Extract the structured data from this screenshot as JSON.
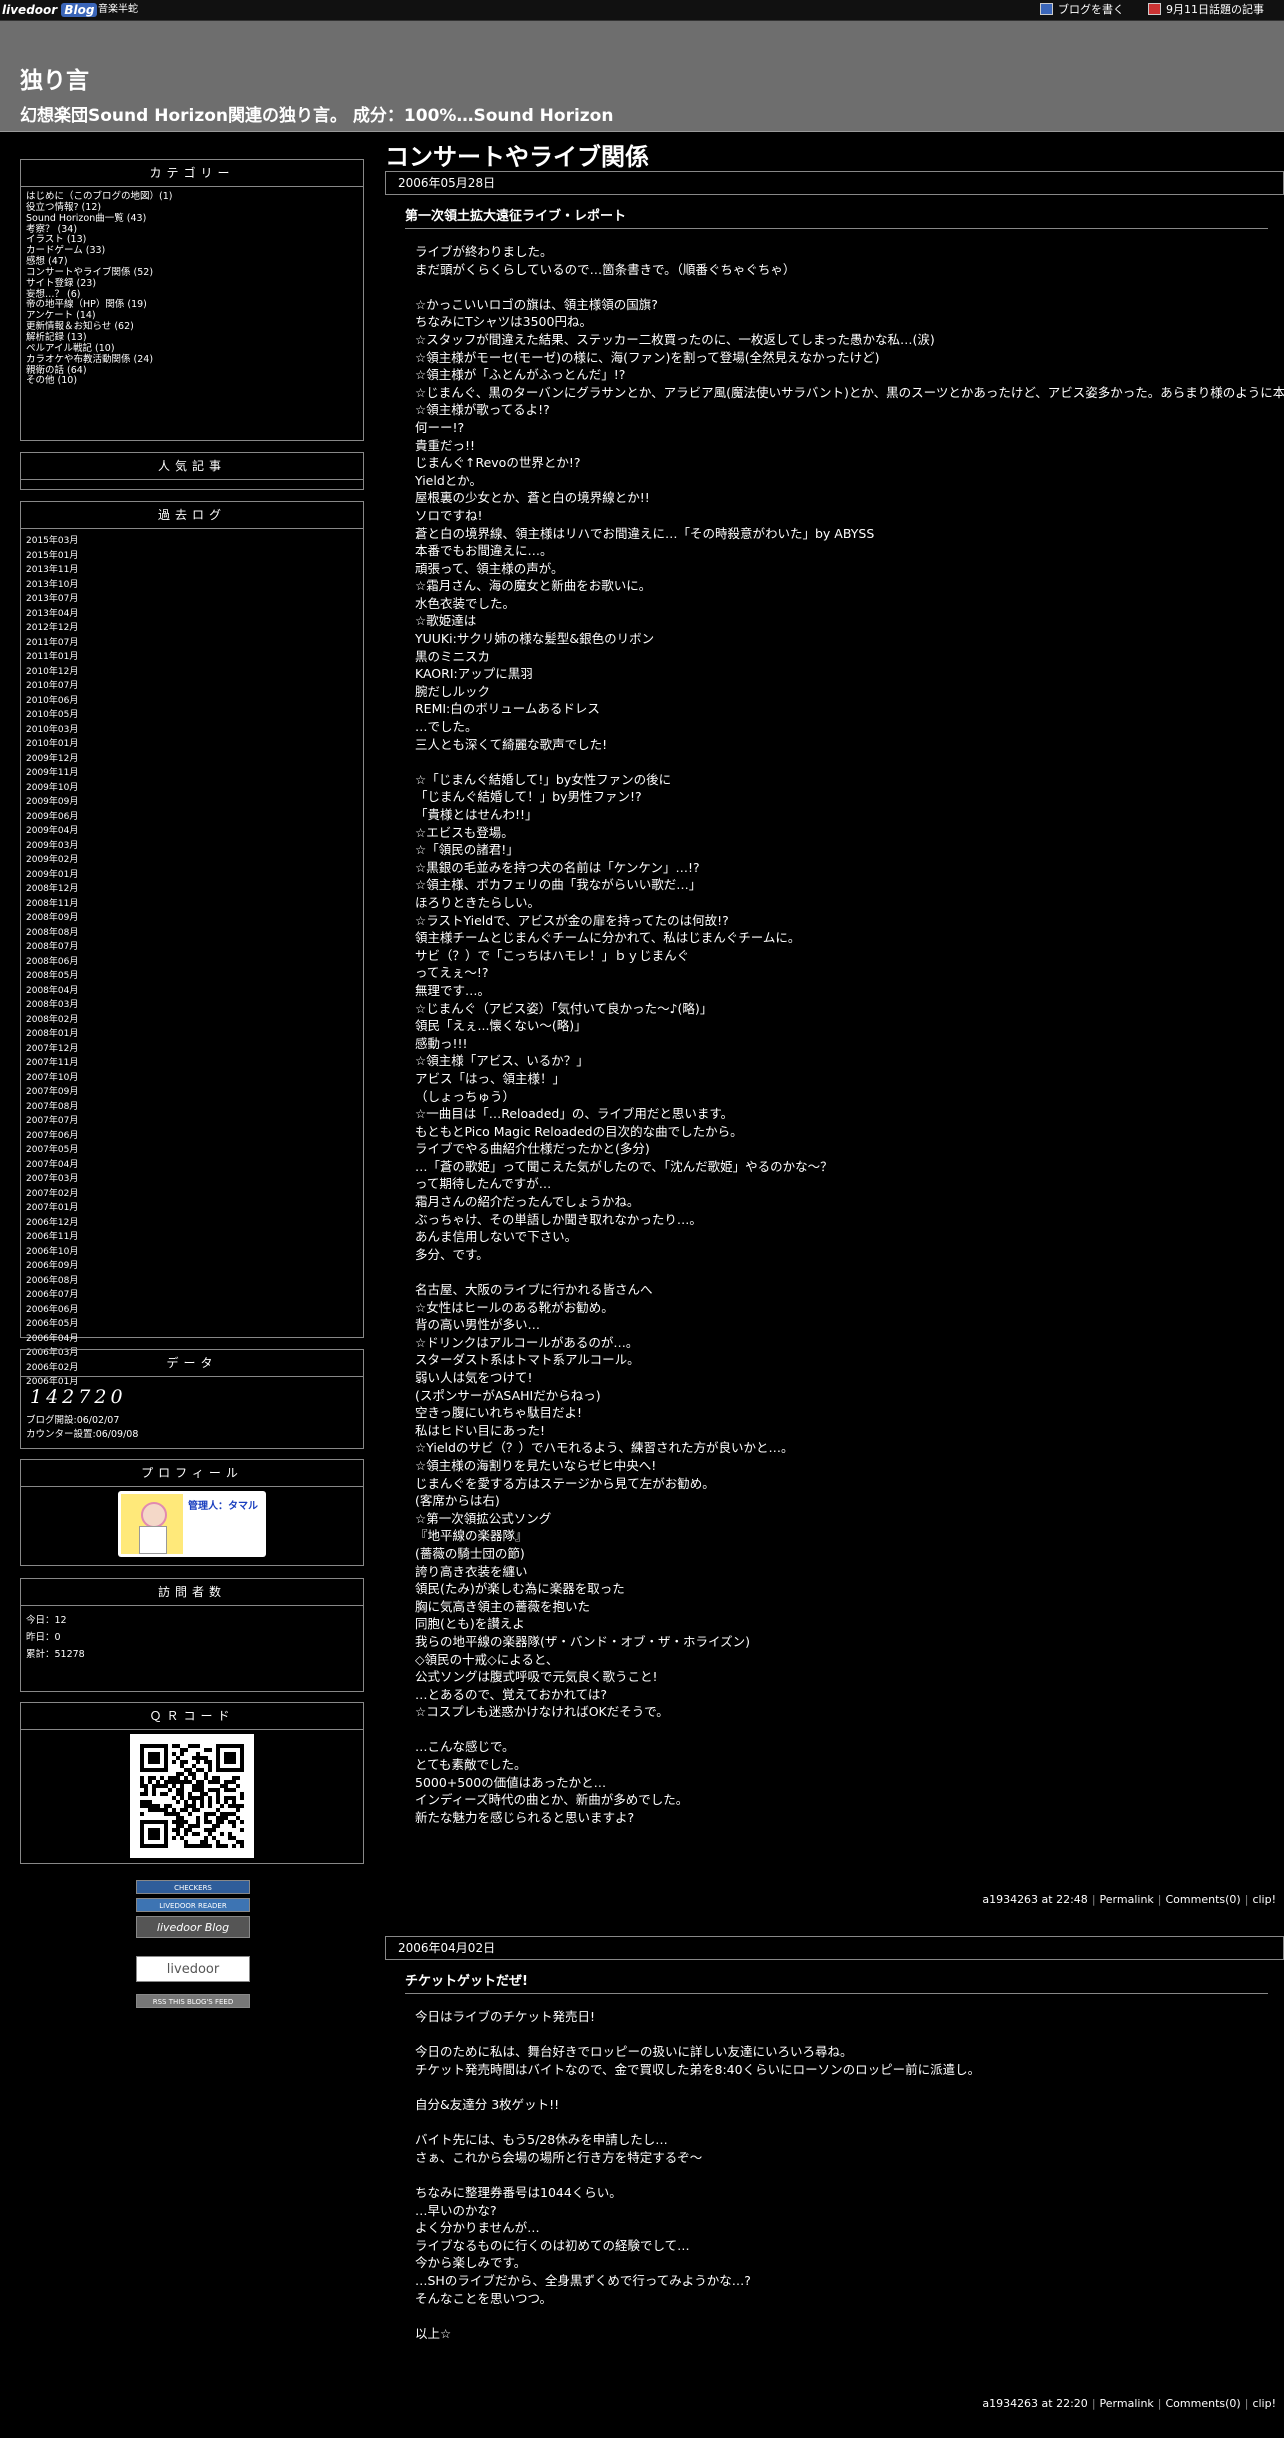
{
  "topbar": {
    "logo_text": "livedoor",
    "logo_blog": "Blog",
    "subtitle": "音楽半蛇",
    "write_label": "ブログを書く",
    "news_label": "9月11日話題の記事"
  },
  "header": {
    "title": "独り言",
    "description": "幻想楽団Sound Horizon関連の独り言。 成分：100%…Sound Horizon"
  },
  "sidebar": {
    "categories": {
      "title": "カテゴリー",
      "items": [
        "はじめに（このブログの地図）(1)",
        "役立つ情報? (12)",
        "Sound Horizon曲一覧 (43)",
        "考察？ (34)",
        "イラスト (13)",
        "カードゲーム (33)",
        "感想 (47)",
        "コンサートやライブ関係 (52)",
        "サイト登録 (23)",
        "妄想…？ (6)",
        "帝の地平線（HP）関係 (19)",
        "アンケート (14)",
        "更新情報＆お知らせ (62)",
        "解析記録 (13)",
        "ペルアイル戦記 (10)",
        "カラオケや布教活動関係 (24)",
        "親衛の話 (64)",
        "その他 (10)"
      ]
    },
    "popular": {
      "title": "人気記事"
    },
    "archives": {
      "title": "過去ログ",
      "items": [
        "2015年03月",
        "2015年01月",
        "2013年11月",
        "2013年10月",
        "2013年07月",
        "2013年04月",
        "2012年12月",
        "2011年07月",
        "2011年01月",
        "2010年12月",
        "2010年07月",
        "2010年06月",
        "2010年05月",
        "2010年03月",
        "2010年01月",
        "2009年12月",
        "2009年11月",
        "2009年10月",
        "2009年09月",
        "2009年06月",
        "2009年04月",
        "2009年03月",
        "2009年02月",
        "2009年01月",
        "2008年12月",
        "2008年11月",
        "2008年09月",
        "2008年08月",
        "2008年07月",
        "2008年06月",
        "2008年05月",
        "2008年04月",
        "2008年03月",
        "2008年02月",
        "2008年01月",
        "2007年12月",
        "2007年11月",
        "2007年10月",
        "2007年09月",
        "2007年08月",
        "2007年07月",
        "2007年06月",
        "2007年05月",
        "2007年04月",
        "2007年03月",
        "2007年02月",
        "2007年01月",
        "2006年12月",
        "2006年11月",
        "2006年10月",
        "2006年09月",
        "2006年08月",
        "2006年07月",
        "2006年06月",
        "2006年05月",
        "2006年04月",
        "2006年03月",
        "2006年02月",
        "2006年01月"
      ]
    },
    "data_box": {
      "title": "データ",
      "counter": "142720",
      "opened": "ブログ開設:06/02/07",
      "counter_set": "カウンター設置:06/09/08"
    },
    "profile": {
      "title": "プロフィール",
      "label": "管理人：タマル"
    },
    "visitors": {
      "title": "訪問者数",
      "today": "今日：12",
      "yesterday": "昨日：0",
      "total": "累計：51278"
    },
    "qr": {
      "title": "ＱＲコード"
    },
    "badges": [
      "CHECKERS",
      "LIVEDOOR READER",
      "livedoor Blog",
      "livedoor",
      "RSS THIS BLOG'S FEED"
    ]
  },
  "main": {
    "page_title": "コンサートやライブ関係",
    "entries": [
      {
        "date": "2006年05月28日",
        "title": "第一次領土拡大遠征ライブ・レポート",
        "lines": [
          "ライブが終わりました。",
          "まだ頭がくらくらしているので…箇条書きで。（順番ぐちゃぐちゃ）",
          "",
          "☆かっこいいロゴの旗は、領主様領の国旗?",
          "ちなみにTシャツは3500円ね。",
          "☆スタッフが間違えた結果、ステッカー二枚買ったのに、一枚返してしまった愚かな私…(涙)",
          "☆領主様がモーセ(モーゼ)の様に、海(ファン)を割って登場(全然見えなかったけど)",
          "☆領主様が「ふとんがふっとんだ」!?",
          "☆じまんぐ、黒のターバンにグラサンとか、アラビア風(魔法使いサラバント)とか、黒のスーツとかあったけど、アビス姿多かった。あらまり様のように本を持って。",
          "☆領主様が歌ってるよ!?",
          "何ーー!?",
          "貴重だっ!!",
          "じまんぐ↑Revoの世界とか!?",
          "Yieldとか。",
          "屋根裏の少女とか、蒼と白の境界線とか!!",
          "ソロですね!",
          "蒼と白の境界線、領主様はリハでお間違えに…「その時殺意がわいた」by ABYSS",
          "本番でもお間違えに…。",
          "頑張って、領主様の声が。",
          "☆霜月さん、海の魔女と新曲をお歌いに。",
          "水色衣装でした。",
          "☆歌姫達は",
          "YUUKi:サクリ姉の様な髪型&銀色のリボン",
          "黒のミニスカ",
          "KAORI:アップに黒羽",
          "腕だしルック",
          "REMI:白のボリュームあるドレス",
          "…でした。",
          "三人とも深くて綺麗な歌声でした!",
          "",
          "☆「じまんぐ結婚して!」by女性ファンの後に",
          "「じまんぐ結婚して！」by男性ファン!?",
          "「貴様とはせんわ!!」",
          "☆エビスも登場。",
          "☆「領民の諸君!」",
          "☆黒銀の毛並みを持つ犬の名前は「ケンケン」…!?",
          "☆領主様、ボカフェリの曲「我ながらいい歌だ…」",
          "ほろりときたらしい。",
          "☆ラストYieldで、アビスが金の扉を持ってたのは何故!?",
          "領主様チームとじまんぐチームに分かれて、私はじまんぐチームに。",
          "サビ（？）で「こっちはハモレ！」ｂｙじまんぐ",
          "ってえぇ〜!?",
          "無理です…。",
          "☆じまんぐ（アビス姿）「気付いて良かった〜♪(略)」",
          "領民「えぇ...懐くない〜(略)」",
          "感動っ!!!",
          "☆領主様「アビス、いるか？」",
          "アビス「はっ、領主様！」",
          "（しょっちゅう）",
          "☆一曲目は「…Reloaded」の、ライブ用だと思います。",
          "もともとPico Magic Reloadedの目次的な曲でしたから。",
          "ライブでやる曲紹介仕様だったかと(多分)",
          "…「蒼の歌姫」って聞こえた気がしたので、「沈んだ歌姫」やるのかな〜？",
          "って期待したんですが…",
          "霜月さんの紹介だったんでしょうかね。",
          "ぶっちゃけ、その単語しか聞き取れなかったり…。",
          "あんま信用しないで下さい。",
          "多分、です。",
          "",
          "名古屋、大阪のライブに行かれる皆さんへ",
          "☆女性はヒールのある靴がお勧め。",
          "背の高い男性が多い…",
          "☆ドリンクはアルコールがあるのが…。",
          "スターダスト系はトマト系アルコール。",
          "弱い人は気をつけて!",
          "(スポンサーがASAHIだからねっ)",
          "空きっ腹にいれちゃ駄目だよ!",
          "私はヒドい目にあった!",
          "☆Yieldのサビ（？）でハモれるよう、練習された方が良いかと…。",
          "☆領主様の海割りを見たいならゼヒ中央へ!",
          "じまんぐを愛する方はステージから見て左がお勧め。",
          "(客席からは右)",
          "☆第一次領拡公式ソング",
          "『地平線の楽器隊』",
          "(薔薇の騎士団の節)",
          "誇り高き衣装を纏い",
          "領民(たみ)が楽しむ為に楽器を取った",
          "胸に気高き領主の薔薇を抱いた",
          "同胞(とも)を讃えよ",
          "我らの地平線の楽器隊(ザ・バンド・オブ・ザ・ホライズン)",
          "◇領民の十戒◇によると、",
          "公式ソングは腹式呼吸で元気良く歌うこと!",
          "…とあるので、覚えておかれては?",
          "☆コスプレも迷惑かけなければOKだそうで。",
          "",
          "…こんな感じで。",
          "とても素敵でした。",
          "5000+500の価値はあったかと…",
          "インディーズ時代の曲とか、新曲が多めでした。",
          "新たな魅力を感じられると思いますよ?"
        ],
        "footer": {
          "meta": "a1934263 at 22:48",
          "permalink": "Permalink",
          "comments": "Comments(0)",
          "clip": "clip!"
        }
      },
      {
        "date": "2006年04月02日",
        "title": "チケットゲットだぜ!",
        "lines": [
          "今日はライブのチケット発売日!",
          "",
          "今日のために私は、舞台好きでロッピーの扱いに詳しい友達にいろいろ尋ね。",
          "チケット発売時間はバイトなので、金で買収した弟を8:40くらいにローソンのロッピー前に派遣し。",
          "",
          "自分&友達分 3枚ゲット!!",
          "",
          "バイト先には、もう5/28休みを申請したし…",
          "さぁ、これから会場の場所と行き方を特定するぞ〜",
          "",
          "ちなみに整理券番号は1044くらい。",
          "…早いのかな?",
          "よく分かりませんが…",
          "ライブなるものに行くのは初めての経験でして…",
          "今から楽しみです。",
          "…SHのライブだから、全身黒ずくめで行ってみようかな…?",
          "そんなことを思いつつ。",
          "",
          "以上☆"
        ],
        "footer": {
          "meta": "a1934263 at 22:20",
          "permalink": "Permalink",
          "comments": "Comments(0)",
          "clip": "clip!"
        }
      }
    ]
  }
}
